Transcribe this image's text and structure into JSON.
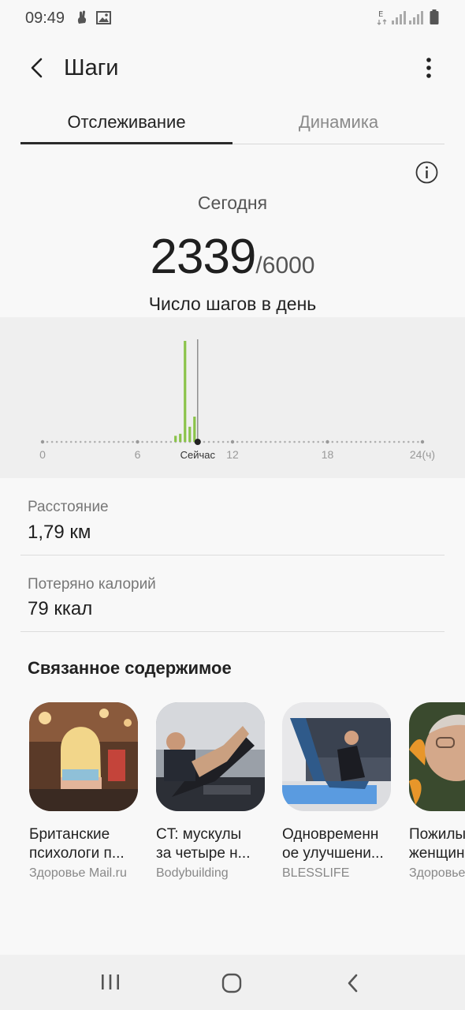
{
  "status_bar": {
    "time": "09:49",
    "left_icons": [
      "hand-notification-icon",
      "image-notification-icon"
    ],
    "right_icons": [
      "data-e-icon",
      "signal-icon",
      "signal-icon-2",
      "battery-icon"
    ],
    "data_indicator": "E"
  },
  "app_bar": {
    "title": "Шаги",
    "back_icon": "back-arrow-icon",
    "more_icon": "more-vert-icon"
  },
  "tabs": [
    {
      "label": "Отслеживание",
      "active": true
    },
    {
      "label": "Динамика",
      "active": false
    }
  ],
  "summary": {
    "period": "Сегодня",
    "steps": "2339",
    "goal": "/6000",
    "caption": "Число шагов в день"
  },
  "chart_data": {
    "type": "bar",
    "x_unit": "hours",
    "x_ticks": [
      "0",
      "6",
      "12",
      "18",
      "24(ч)"
    ],
    "now_label": "Сейчас",
    "now_hour": 9.8,
    "bars": [
      {
        "hour": 8.4,
        "value": 6
      },
      {
        "hour": 8.7,
        "value": 8
      },
      {
        "hour": 9.0,
        "value": 100
      },
      {
        "hour": 9.3,
        "value": 15
      },
      {
        "hour": 9.6,
        "value": 25
      }
    ],
    "colors": {
      "bar": "#8bc34a",
      "now_line": "#777777",
      "dots": "#b0b0b0"
    }
  },
  "metrics": [
    {
      "label": "Расстояние",
      "value": "1,79 км"
    },
    {
      "label": "Потеряно калорий",
      "value": "79 ккал"
    }
  ],
  "related": {
    "title": "Связанное содержимое",
    "items": [
      {
        "title": "Британские",
        "title2": "психологи п...",
        "source": "Здоровье Mail.ru"
      },
      {
        "title": "CT: мускулы",
        "title2": "за четыре н...",
        "source": "Bodybuilding"
      },
      {
        "title": "Одновременн",
        "title2": "ое улучшени...",
        "source": "BLESSLIFE"
      },
      {
        "title": "Пожилы",
        "title2": "женщин",
        "source": "Здоровье"
      }
    ]
  },
  "nav": {
    "recent_icon": "recent-apps-icon",
    "home_icon": "home-icon",
    "back_icon": "nav-back-icon"
  }
}
